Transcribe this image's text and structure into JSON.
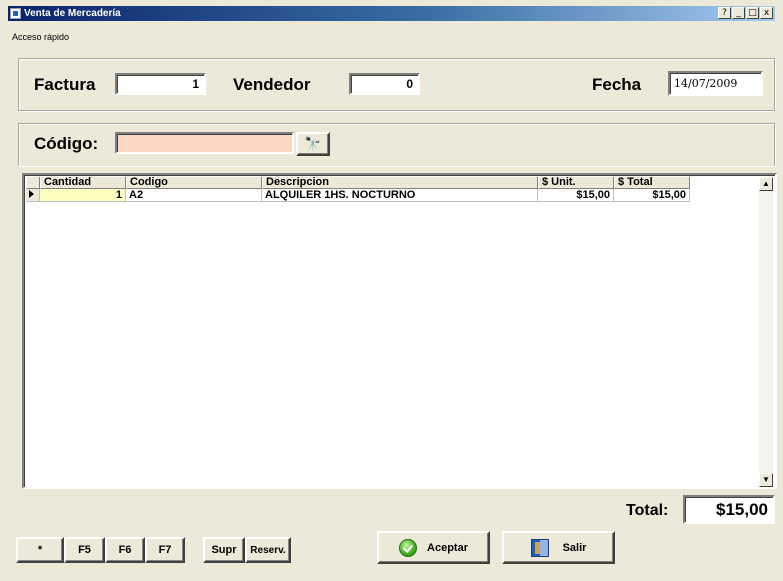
{
  "window": {
    "title": "Venta de Mercadería",
    "help_btn": "?",
    "minimize_btn": "_",
    "maximize_btn": "□",
    "close_btn": "x"
  },
  "menu": {
    "quick_access": "Acceso rápido"
  },
  "header": {
    "factura_label": "Factura",
    "factura_value": "1",
    "vendedor_label": "Vendedor",
    "vendedor_value": "0",
    "fecha_label": "Fecha",
    "fecha_value": "14/07/2009"
  },
  "search": {
    "codigo_label": "Código:",
    "codigo_value": ""
  },
  "table": {
    "columns": [
      "Cantidad",
      "Codigo",
      "Descripcion",
      "$ Unit.",
      "$ Total"
    ],
    "rows": [
      {
        "cantidad": "1",
        "codigo": "A2",
        "descripcion": "ALQUILER 1HS. NOCTURNO",
        "unit": "$15,00",
        "total": "$15,00"
      }
    ]
  },
  "footer": {
    "total_label": "Total:",
    "total_value": "$15,00",
    "fkeys": [
      "*",
      "F5",
      "F6",
      "F7",
      "Supr",
      "Reserv."
    ],
    "aceptar_label": "Aceptar",
    "salir_label": "Salir"
  },
  "icons": {
    "app": "window-icon",
    "search": "binoculars-icon",
    "accept": "check-circle-icon",
    "exit": "door-icon",
    "row_indicator": "triangle-right-icon"
  },
  "colors": {
    "codigo_bg": "#fbd6c3",
    "quantity_cell_bg": "#ffffc0",
    "titlebar": "#0a246a"
  }
}
